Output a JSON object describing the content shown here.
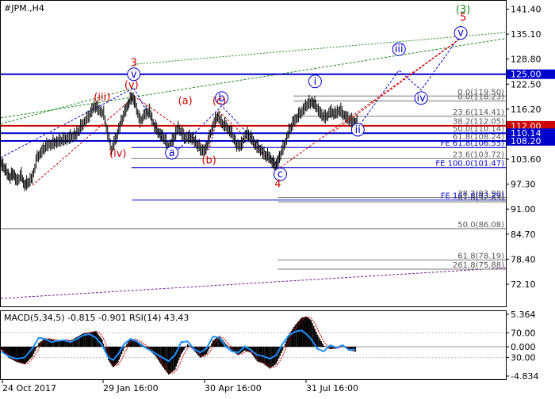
{
  "chart_data": {
    "type": "line",
    "title": "#JPM.,H4",
    "main": {
      "ylim": [
        66.5,
        143.5
      ],
      "y_ticks": [
        141.4,
        135.1,
        128.8,
        122.5,
        116.2,
        109.9,
        103.6,
        97.3,
        91.0,
        84.7,
        78.4,
        72.1
      ],
      "x_labels": [
        "24 Oct 2017",
        "29 Jan 16:00",
        "30 Apr 16:00",
        "31 Jul 16:00"
      ],
      "price_series_approx": [
        {
          "t": 0,
          "v": 102.5
        },
        {
          "t": 4,
          "v": 101.5
        },
        {
          "t": 8,
          "v": 100
        },
        {
          "t": 12,
          "v": 99
        },
        {
          "t": 16,
          "v": 100
        },
        {
          "t": 20,
          "v": 98
        },
        {
          "t": 26,
          "v": 99.5
        },
        {
          "t": 30,
          "v": 97
        },
        {
          "t": 34,
          "v": 97.5
        },
        {
          "t": 40,
          "v": 99
        },
        {
          "t": 46,
          "v": 104
        },
        {
          "t": 52,
          "v": 105.5
        },
        {
          "t": 58,
          "v": 107
        },
        {
          "t": 66,
          "v": 107.5
        },
        {
          "t": 72,
          "v": 108
        },
        {
          "t": 80,
          "v": 108.5
        },
        {
          "t": 88,
          "v": 109
        },
        {
          "t": 96,
          "v": 110
        },
        {
          "t": 104,
          "v": 112.5
        },
        {
          "t": 112,
          "v": 114.5
        },
        {
          "t": 118,
          "v": 117
        },
        {
          "t": 124,
          "v": 116
        },
        {
          "t": 130,
          "v": 115
        },
        {
          "t": 135,
          "v": 110
        },
        {
          "t": 140,
          "v": 106
        },
        {
          "t": 146,
          "v": 109
        },
        {
          "t": 152,
          "v": 113
        },
        {
          "t": 158,
          "v": 116
        },
        {
          "t": 162,
          "v": 118
        },
        {
          "t": 166,
          "v": 119.3
        },
        {
          "t": 170,
          "v": 117.5
        },
        {
          "t": 176,
          "v": 113
        },
        {
          "t": 182,
          "v": 115
        },
        {
          "t": 188,
          "v": 115.5
        },
        {
          "t": 194,
          "v": 112
        },
        {
          "t": 200,
          "v": 110
        },
        {
          "t": 206,
          "v": 109
        },
        {
          "t": 212,
          "v": 106.5
        },
        {
          "t": 218,
          "v": 108.5
        },
        {
          "t": 224,
          "v": 111.5
        },
        {
          "t": 232,
          "v": 109
        },
        {
          "t": 240,
          "v": 109
        },
        {
          "t": 246,
          "v": 108
        },
        {
          "t": 252,
          "v": 106
        },
        {
          "t": 258,
          "v": 105.5
        },
        {
          "t": 262,
          "v": 108
        },
        {
          "t": 268,
          "v": 112
        },
        {
          "t": 274,
          "v": 114.5
        },
        {
          "t": 280,
          "v": 112.5
        },
        {
          "t": 286,
          "v": 111.5
        },
        {
          "t": 292,
          "v": 110
        },
        {
          "t": 298,
          "v": 107
        },
        {
          "t": 304,
          "v": 107
        },
        {
          "t": 310,
          "v": 110
        },
        {
          "t": 316,
          "v": 109
        },
        {
          "t": 322,
          "v": 107
        },
        {
          "t": 328,
          "v": 106
        },
        {
          "t": 334,
          "v": 104.5
        },
        {
          "t": 340,
          "v": 104
        },
        {
          "t": 344,
          "v": 102.5
        },
        {
          "t": 348,
          "v": 102
        },
        {
          "t": 352,
          "v": 104
        },
        {
          "t": 358,
          "v": 107
        },
        {
          "t": 364,
          "v": 110.5
        },
        {
          "t": 370,
          "v": 113
        },
        {
          "t": 376,
          "v": 114.5
        },
        {
          "t": 382,
          "v": 116
        },
        {
          "t": 388,
          "v": 117.5
        },
        {
          "t": 394,
          "v": 118
        },
        {
          "t": 398,
          "v": 117
        },
        {
          "t": 404,
          "v": 115
        },
        {
          "t": 410,
          "v": 114
        },
        {
          "t": 416,
          "v": 115.5
        },
        {
          "t": 422,
          "v": 115
        },
        {
          "t": 428,
          "v": 116
        },
        {
          "t": 434,
          "v": 114.5
        },
        {
          "t": 440,
          "v": 113.5
        },
        {
          "t": 446,
          "v": 113
        },
        {
          "t": 450,
          "v": 112.5
        }
      ],
      "horizontal_lines": [
        {
          "label": "125.00",
          "price": 125.0,
          "color": "#0000cc",
          "tag": true
        },
        {
          "label": "112.00",
          "price": 112.0,
          "color": "#cc0000",
          "tag": true
        },
        {
          "label": "110.14",
          "price": 110.14,
          "color": "#0000cc",
          "tag": true
        },
        {
          "label": "108.20",
          "price": 108.2,
          "color": "#0000cc",
          "tag": true
        },
        {
          "label": "FE 100.0(101.47)",
          "price": 101.47,
          "color": "#0000cc",
          "tag": false
        }
      ],
      "fib_retracement_labels": [
        {
          "text": "0.0(119.50)",
          "price": 119.5
        },
        {
          "text": "0.0(118.23)",
          "price": 118.23
        },
        {
          "text": "23.6(114.41)",
          "price": 114.41
        },
        {
          "text": "38.2(112.05)",
          "price": 112.05
        },
        {
          "text": "50.0(110.14)",
          "price": 110.14
        },
        {
          "text": "61.8(108.24)",
          "price": 108.24
        },
        {
          "text": "FE 61.8(106.55)",
          "price": 106.55
        },
        {
          "text": "23.6(103.72)",
          "price": 103.72
        },
        {
          "text": "38.2(93.90)",
          "price": 93.9
        },
        {
          "text": "FE 161.8(93.29)",
          "price": 93.29
        },
        {
          "text": "61.8(92.83)",
          "price": 92.83
        },
        {
          "text": "50.0(86.08)",
          "price": 86.08
        },
        {
          "text": "61.8(78.19)",
          "price": 78.19
        },
        {
          "text": "261.8(75.88)",
          "price": 75.88
        }
      ],
      "wave_labels": [
        {
          "text": "(3)",
          "t": 584,
          "v": 140.5,
          "color": "#1a8a1a",
          "circle": false
        },
        {
          "text": "v",
          "t": 581,
          "v": 134.6,
          "color": "#0000cc",
          "circle": true
        },
        {
          "text": "5",
          "t": 584,
          "v": 138.5,
          "color": "#cc0000",
          "circle": false
        },
        {
          "text": "iii",
          "t": 503,
          "v": 130.5,
          "color": "#0000cc",
          "circle": true
        },
        {
          "text": "iv",
          "t": 531,
          "v": 118.2,
          "color": "#0000cc",
          "circle": true
        },
        {
          "text": "i",
          "t": 397,
          "v": 122.4,
          "color": "#0000cc",
          "circle": true
        },
        {
          "text": "ii",
          "t": 451,
          "v": 110.2,
          "color": "#0000cc",
          "circle": true
        },
        {
          "text": "3",
          "t": 168,
          "v": 127.0,
          "color": "#cc0000",
          "circle": false
        },
        {
          "text": "v",
          "t": 168,
          "v": 124.2,
          "color": "#0000cc",
          "circle": true
        },
        {
          "text": "(v)",
          "t": 165,
          "v": 121.5,
          "color": "#cc0000",
          "circle": false
        },
        {
          "text": "(iii)",
          "t": 128,
          "v": 118.4,
          "color": "#cc0000",
          "circle": false
        },
        {
          "text": "(iv)",
          "t": 148,
          "v": 104.2,
          "color": "#cc0000",
          "circle": false
        },
        {
          "text": "a",
          "t": 216,
          "v": 104.4,
          "color": "#0000cc",
          "circle": true
        },
        {
          "text": "(a)",
          "t": 233,
          "v": 117.5,
          "color": "#cc0000",
          "circle": false
        },
        {
          "text": "b",
          "t": 279,
          "v": 118.2,
          "color": "#0000cc",
          "circle": true
        },
        {
          "text": "(c)",
          "t": 276,
          "v": 117.5,
          "color": "#cc0000",
          "circle": false
        },
        {
          "text": "(b)",
          "t": 263,
          "v": 102.5,
          "color": "#cc0000",
          "circle": false
        },
        {
          "text": "c",
          "t": 353,
          "v": 99.0,
          "color": "#0000cc",
          "circle": true
        },
        {
          "text": "4",
          "t": 350,
          "v": 96.5,
          "color": "#cc0000",
          "circle": false
        }
      ]
    },
    "indicator": {
      "header": "MACD(5,34,5) -0.815 -0.901 RSI(14) 43.43",
      "y_ticks": [
        "5.364",
        "70.00",
        "0.000",
        "30.00",
        "-4.834"
      ],
      "macd_histogram_approx": [
        {
          "t": 0,
          "v": -0.4
        },
        {
          "t": 10,
          "v": -1.8
        },
        {
          "t": 20,
          "v": -2.5
        },
        {
          "t": 30,
          "v": -2.9
        },
        {
          "t": 40,
          "v": -1.6
        },
        {
          "t": 48,
          "v": 0.6
        },
        {
          "t": 56,
          "v": 1.4
        },
        {
          "t": 64,
          "v": 1.2
        },
        {
          "t": 72,
          "v": 1.0
        },
        {
          "t": 80,
          "v": 1.2
        },
        {
          "t": 88,
          "v": 1.0
        },
        {
          "t": 96,
          "v": 1.6
        },
        {
          "t": 104,
          "v": 2.2
        },
        {
          "t": 112,
          "v": 2.4
        },
        {
          "t": 120,
          "v": 2.6
        },
        {
          "t": 128,
          "v": 1.2
        },
        {
          "t": 136,
          "v": -2.2
        },
        {
          "t": 142,
          "v": -3.4
        },
        {
          "t": 148,
          "v": -2.6
        },
        {
          "t": 156,
          "v": -0.2
        },
        {
          "t": 164,
          "v": 1.4
        },
        {
          "t": 172,
          "v": 1.0
        },
        {
          "t": 180,
          "v": 0.3
        },
        {
          "t": 188,
          "v": -0.6
        },
        {
          "t": 196,
          "v": -1.6
        },
        {
          "t": 204,
          "v": -3.2
        },
        {
          "t": 212,
          "v": -4.6
        },
        {
          "t": 220,
          "v": -3.8
        },
        {
          "t": 228,
          "v": -1.2
        },
        {
          "t": 236,
          "v": 0.4
        },
        {
          "t": 244,
          "v": -0.6
        },
        {
          "t": 252,
          "v": -1.8
        },
        {
          "t": 260,
          "v": -1.2
        },
        {
          "t": 268,
          "v": 1.0
        },
        {
          "t": 276,
          "v": 1.8
        },
        {
          "t": 284,
          "v": 0.5
        },
        {
          "t": 292,
          "v": -0.6
        },
        {
          "t": 300,
          "v": -1.4
        },
        {
          "t": 308,
          "v": -0.6
        },
        {
          "t": 316,
          "v": -1.0
        },
        {
          "t": 324,
          "v": -2.4
        },
        {
          "t": 332,
          "v": -2.8
        },
        {
          "t": 340,
          "v": -3.6
        },
        {
          "t": 348,
          "v": -2.8
        },
        {
          "t": 356,
          "v": -0.6
        },
        {
          "t": 364,
          "v": 2.0
        },
        {
          "t": 372,
          "v": 3.6
        },
        {
          "t": 380,
          "v": 4.8
        },
        {
          "t": 386,
          "v": 5.0
        },
        {
          "t": 392,
          "v": 4.4
        },
        {
          "t": 400,
          "v": 2.0
        },
        {
          "t": 408,
          "v": 0.2
        },
        {
          "t": 416,
          "v": -0.4
        },
        {
          "t": 424,
          "v": -0.2
        },
        {
          "t": 432,
          "v": 0.2
        },
        {
          "t": 440,
          "v": -0.6
        },
        {
          "t": 448,
          "v": -0.8
        }
      ],
      "rsi_approx": [
        {
          "t": 0,
          "v": 40
        },
        {
          "t": 10,
          "v": 32
        },
        {
          "t": 20,
          "v": 28
        },
        {
          "t": 30,
          "v": 30
        },
        {
          "t": 40,
          "v": 45
        },
        {
          "t": 48,
          "v": 62
        },
        {
          "t": 56,
          "v": 60
        },
        {
          "t": 64,
          "v": 55
        },
        {
          "t": 72,
          "v": 57
        },
        {
          "t": 80,
          "v": 58
        },
        {
          "t": 88,
          "v": 55
        },
        {
          "t": 96,
          "v": 60
        },
        {
          "t": 104,
          "v": 66
        },
        {
          "t": 112,
          "v": 68
        },
        {
          "t": 120,
          "v": 62
        },
        {
          "t": 128,
          "v": 50
        },
        {
          "t": 136,
          "v": 30
        },
        {
          "t": 142,
          "v": 26
        },
        {
          "t": 148,
          "v": 35
        },
        {
          "t": 156,
          "v": 52
        },
        {
          "t": 164,
          "v": 60
        },
        {
          "t": 172,
          "v": 56
        },
        {
          "t": 180,
          "v": 48
        },
        {
          "t": 188,
          "v": 42
        },
        {
          "t": 196,
          "v": 36
        },
        {
          "t": 204,
          "v": 30
        },
        {
          "t": 212,
          "v": 24
        },
        {
          "t": 220,
          "v": 34
        },
        {
          "t": 228,
          "v": 55
        },
        {
          "t": 236,
          "v": 56
        },
        {
          "t": 244,
          "v": 44
        },
        {
          "t": 252,
          "v": 38
        },
        {
          "t": 260,
          "v": 45
        },
        {
          "t": 268,
          "v": 64
        },
        {
          "t": 276,
          "v": 62
        },
        {
          "t": 284,
          "v": 48
        },
        {
          "t": 292,
          "v": 40
        },
        {
          "t": 300,
          "v": 38
        },
        {
          "t": 308,
          "v": 48
        },
        {
          "t": 316,
          "v": 42
        },
        {
          "t": 324,
          "v": 34
        },
        {
          "t": 332,
          "v": 32
        },
        {
          "t": 340,
          "v": 28
        },
        {
          "t": 348,
          "v": 34
        },
        {
          "t": 356,
          "v": 52
        },
        {
          "t": 364,
          "v": 66
        },
        {
          "t": 372,
          "v": 72
        },
        {
          "t": 380,
          "v": 74
        },
        {
          "t": 386,
          "v": 68
        },
        {
          "t": 392,
          "v": 60
        },
        {
          "t": 400,
          "v": 44
        },
        {
          "t": 408,
          "v": 40
        },
        {
          "t": 416,
          "v": 50
        },
        {
          "t": 424,
          "v": 46
        },
        {
          "t": 432,
          "v": 50
        },
        {
          "t": 440,
          "v": 42
        },
        {
          "t": 448,
          "v": 43
        }
      ]
    }
  }
}
